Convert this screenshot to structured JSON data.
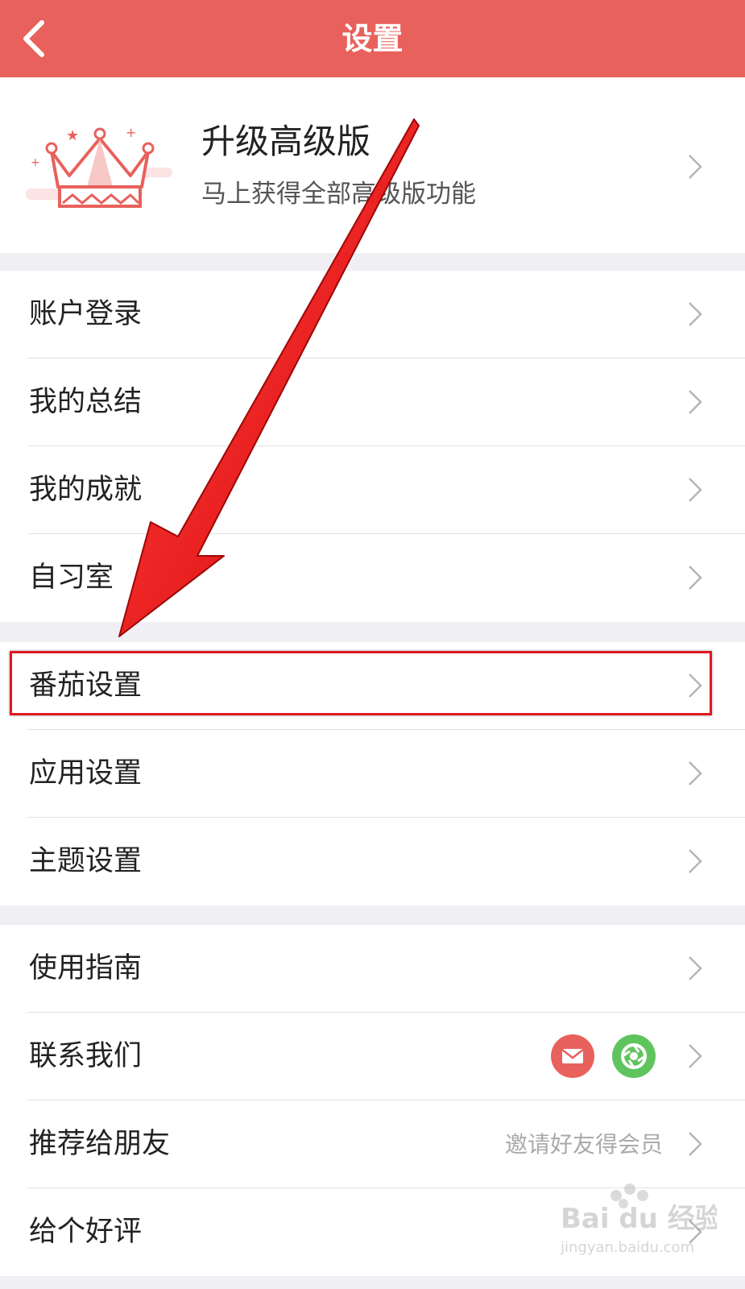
{
  "header": {
    "title": "设置"
  },
  "premium": {
    "title": "升级高级版",
    "subtitle": "马上获得全部高级版功能"
  },
  "groups": [
    {
      "items": [
        {
          "label": "账户登录"
        },
        {
          "label": "我的总结"
        },
        {
          "label": "我的成就"
        },
        {
          "label": "自习室"
        }
      ]
    },
    {
      "items": [
        {
          "label": "番茄设置"
        },
        {
          "label": "应用设置"
        },
        {
          "label": "主题设置"
        }
      ]
    },
    {
      "items": [
        {
          "label": "使用指南"
        },
        {
          "label": "联系我们"
        },
        {
          "label": "推荐给朋友",
          "hint": "邀请好友得会员"
        },
        {
          "label": "给个好评"
        }
      ]
    }
  ],
  "watermark": {
    "brand": "Bai du 经验",
    "url": "jingyan.baidu.com"
  },
  "colors": {
    "accent": "#e8615c",
    "highlight": "#e0181f",
    "wechat": "#5fc45e"
  }
}
